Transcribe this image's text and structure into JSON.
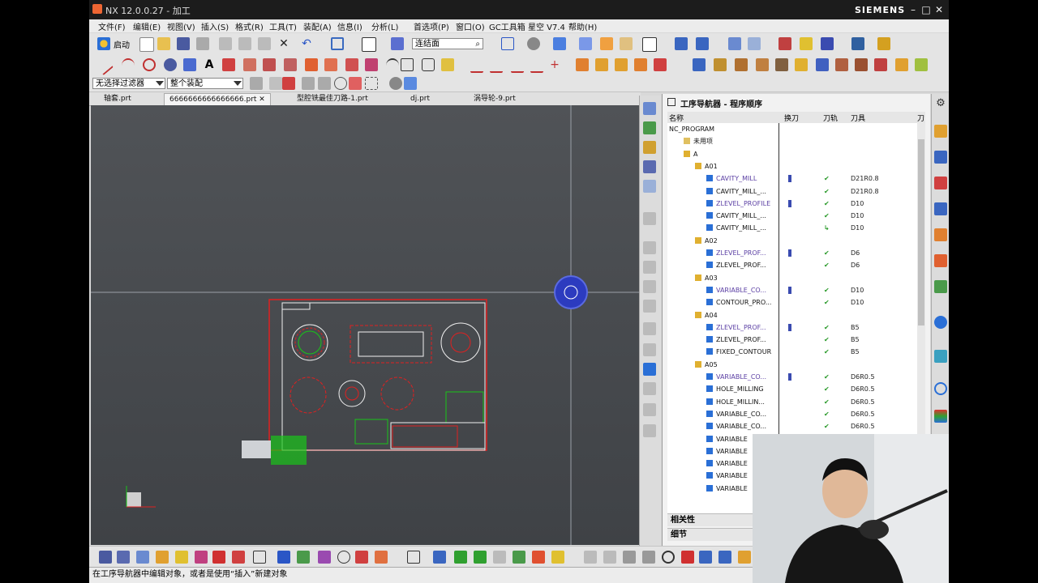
{
  "window": {
    "title": "NX 12.0.0.27 - 加工",
    "brand": "SIEMENS",
    "min": "–",
    "max": "□",
    "close": "✕"
  },
  "menu": [
    "文件(F)",
    "编辑(E)",
    "视图(V)",
    "插入(S)",
    "格式(R)",
    "工具(T)",
    "装配(A)",
    "信息(I)",
    "分析(L)",
    "首选项(P)",
    "窗口(O)",
    "GC工具箱",
    "星空 V7.4",
    "帮助(H)"
  ],
  "toolbar1": {
    "start_label": "启动",
    "snap_combo": "连结面"
  },
  "toolbar3": {
    "filter_combo": "无选择过滤器",
    "assembly_combo": "整个装配"
  },
  "tabs": [
    "轴套.prt",
    "6666666666666666.prt",
    "型腔铣最佳刀路-1.prt",
    "dj.prt",
    "涡导轮-9.prt"
  ],
  "nav": {
    "title": "工序导航器 - 程序顺序",
    "columns": {
      "name": "名称",
      "toolchange": "换刀",
      "path": "刀轨",
      "tool": "刀具",
      "more": "刀"
    },
    "rows": [
      {
        "name": "NC_PROGRAM",
        "indent": 0,
        "kind": "root"
      },
      {
        "name": "未用项",
        "indent": 1,
        "kind": "folder"
      },
      {
        "name": "A",
        "indent": 1,
        "kind": "group"
      },
      {
        "name": "A01",
        "indent": 2,
        "kind": "group"
      },
      {
        "name": "CAVITY_MILL",
        "indent": 3,
        "kind": "op",
        "purple": true,
        "bar": true,
        "check": "✔",
        "tool": "D21R0.8"
      },
      {
        "name": "CAVITY_MILL_...",
        "indent": 3,
        "kind": "op",
        "check": "✔",
        "tool": "D21R0.8"
      },
      {
        "name": "ZLEVEL_PROFILE",
        "indent": 3,
        "kind": "op",
        "purple": true,
        "bar": true,
        "check": "✔",
        "tool": "D10"
      },
      {
        "name": "CAVITY_MILL_...",
        "indent": 3,
        "kind": "op",
        "check": "✔",
        "tool": "D10"
      },
      {
        "name": "CAVITY_MILL_...",
        "indent": 3,
        "kind": "op",
        "check": "↳",
        "tool": "D10"
      },
      {
        "name": "A02",
        "indent": 2,
        "kind": "group"
      },
      {
        "name": "ZLEVEL_PROF...",
        "indent": 3,
        "kind": "op",
        "purple": true,
        "bar": true,
        "check": "✔",
        "tool": "D6"
      },
      {
        "name": "ZLEVEL_PROF...",
        "indent": 3,
        "kind": "op",
        "check": "✔",
        "tool": "D6"
      },
      {
        "name": "A03",
        "indent": 2,
        "kind": "group"
      },
      {
        "name": "VARIABLE_CO...",
        "indent": 3,
        "kind": "op",
        "purple": true,
        "bar": true,
        "check": "✔",
        "tool": "D10"
      },
      {
        "name": "CONTOUR_PRO...",
        "indent": 3,
        "kind": "op",
        "check": "✔",
        "tool": "D10"
      },
      {
        "name": "A04",
        "indent": 2,
        "kind": "group"
      },
      {
        "name": "ZLEVEL_PROF...",
        "indent": 3,
        "kind": "op",
        "purple": true,
        "bar": true,
        "check": "✔",
        "tool": "B5"
      },
      {
        "name": "ZLEVEL_PROF...",
        "indent": 3,
        "kind": "op",
        "check": "✔",
        "tool": "B5"
      },
      {
        "name": "FIXED_CONTOUR",
        "indent": 3,
        "kind": "op",
        "check": "✔",
        "tool": "B5"
      },
      {
        "name": "A05",
        "indent": 2,
        "kind": "group"
      },
      {
        "name": "VARIABLE_CO...",
        "indent": 3,
        "kind": "op",
        "purple": true,
        "bar": true,
        "check": "✔",
        "tool": "D6R0.5"
      },
      {
        "name": "HOLE_MILLING",
        "indent": 3,
        "kind": "op",
        "check": "✔",
        "tool": "D6R0.5"
      },
      {
        "name": "HOLE_MILLIN...",
        "indent": 3,
        "kind": "op",
        "check": "✔",
        "tool": "D6R0.5"
      },
      {
        "name": "VARIABLE_CO...",
        "indent": 3,
        "kind": "op",
        "check": "✔",
        "tool": "D6R0.5"
      },
      {
        "name": "VARIABLE_CO...",
        "indent": 3,
        "kind": "op",
        "check": "✔",
        "tool": "D6R0.5"
      },
      {
        "name": "VARIABLE",
        "indent": 3,
        "kind": "op"
      },
      {
        "name": "VARIABLE",
        "indent": 3,
        "kind": "op"
      },
      {
        "name": "VARIABLE",
        "indent": 3,
        "kind": "op"
      },
      {
        "name": "VARIABLE",
        "indent": 3,
        "kind": "op"
      },
      {
        "name": "VARIABLE",
        "indent": 3,
        "kind": "op"
      }
    ],
    "sections": {
      "dependencies": "相关性",
      "details": "细节"
    }
  },
  "status": "在工序导航器中编辑对象，或者是使用“插入”新建对象",
  "colors": {
    "accent": "#3a4bb0",
    "purple_op": "#5a3ea3",
    "check": "#2a9a2a",
    "drawing_red": "#e02020",
    "drawing_green": "#19c419"
  }
}
